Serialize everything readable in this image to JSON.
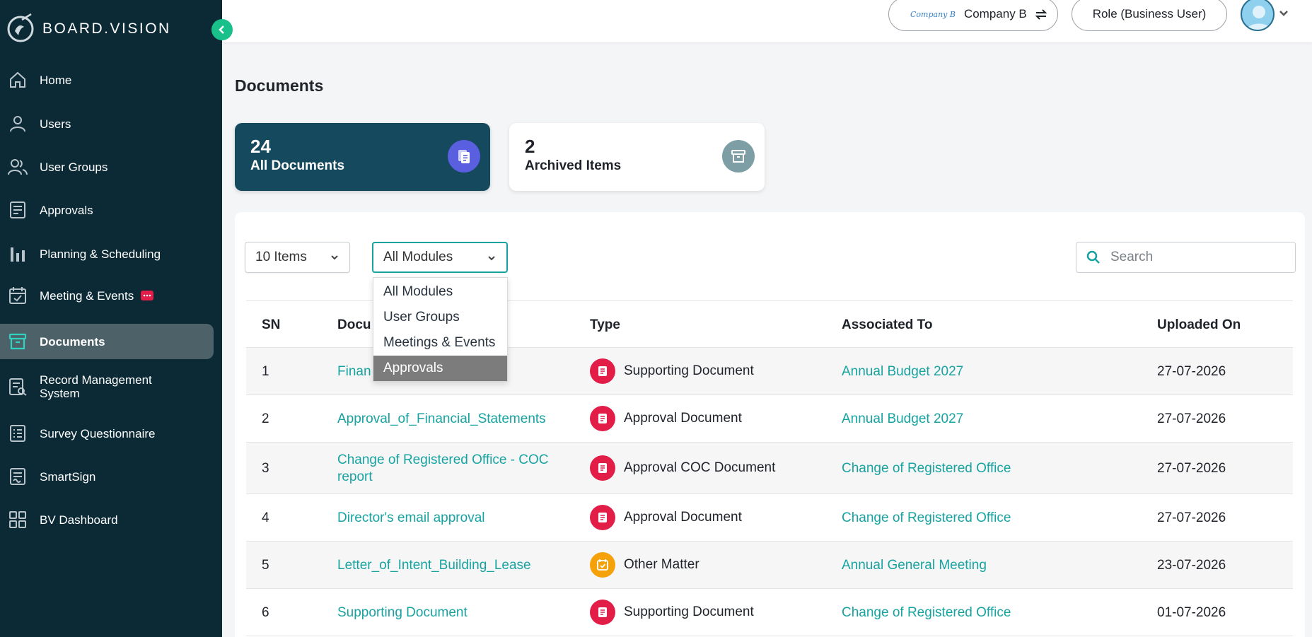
{
  "brand": {
    "name": "BOARD.VISION"
  },
  "sidebar": {
    "items": [
      {
        "label": "Home",
        "icon": "home-icon",
        "active": false
      },
      {
        "label": "Users",
        "icon": "user-icon",
        "active": false
      },
      {
        "label": "User Groups",
        "icon": "users-icon",
        "active": false
      },
      {
        "label": "Approvals",
        "icon": "approvals-icon",
        "active": false
      },
      {
        "label": "Planning & Scheduling",
        "icon": "bar-chart-icon",
        "active": false
      },
      {
        "label": "Meeting & Events",
        "icon": "calendar-check-icon",
        "active": false,
        "badge": "chat-icon"
      },
      {
        "label": "Documents",
        "icon": "archive-icon",
        "active": true
      },
      {
        "label": "Record Management System",
        "icon": "record-search-icon",
        "active": false
      },
      {
        "label": "Survey Questionnaire",
        "icon": "survey-icon",
        "active": false
      },
      {
        "label": "SmartSign",
        "icon": "smartsign-icon",
        "active": false
      },
      {
        "label": "BV Dashboard",
        "icon": "dashboard-grid-icon",
        "active": false
      }
    ]
  },
  "topbar": {
    "company_logo_text": "Company B",
    "company_name": "Company B",
    "role": "Role (Business User)"
  },
  "page": {
    "title": "Documents"
  },
  "stats": {
    "all": {
      "count": "24",
      "label": "All Documents"
    },
    "archived": {
      "count": "2",
      "label": "Archived Items"
    }
  },
  "filters": {
    "items_per_page": "10 Items",
    "module": "All Modules",
    "module_options": [
      "All Modules",
      "User Groups",
      "Meetings & Events",
      "Approvals"
    ],
    "highlighted_option": "Approvals",
    "search_placeholder": "Search"
  },
  "table": {
    "columns": [
      "SN",
      "Docu",
      "Type",
      "Associated To",
      "Uploaded On"
    ],
    "rows": [
      {
        "sn": "1",
        "name": "Finan",
        "type": "Supporting Document",
        "type_kind": "doc",
        "associated": "Annual Budget 2027",
        "date": "27-07-2026"
      },
      {
        "sn": "2",
        "name": "Approval_of_Financial_Statements",
        "type": "Approval Document",
        "type_kind": "doc",
        "associated": "Annual Budget 2027",
        "date": "27-07-2026"
      },
      {
        "sn": "3",
        "name": "Change of Registered Office - COC report",
        "type": "Approval COC Document",
        "type_kind": "doc",
        "associated": "Change of Registered Office",
        "date": "27-07-2026"
      },
      {
        "sn": "4",
        "name": "Director's email approval",
        "type": "Approval Document",
        "type_kind": "doc",
        "associated": "Change of Registered Office",
        "date": "27-07-2026"
      },
      {
        "sn": "5",
        "name": "Letter_of_Intent_Building_Lease",
        "type": "Other Matter",
        "type_kind": "other",
        "associated": "Annual General Meeting",
        "date": "23-07-2026"
      },
      {
        "sn": "6",
        "name": "Supporting Document",
        "type": "Supporting Document",
        "type_kind": "doc",
        "associated": "Change of Registered Office",
        "date": "01-07-2026"
      }
    ]
  },
  "colors": {
    "sidebar_bg": "#0b2a36",
    "accent_teal": "#17a3a0",
    "primary_card": "#154a5e",
    "doc_icon": "#e11d48",
    "other_icon": "#f5a10a"
  }
}
